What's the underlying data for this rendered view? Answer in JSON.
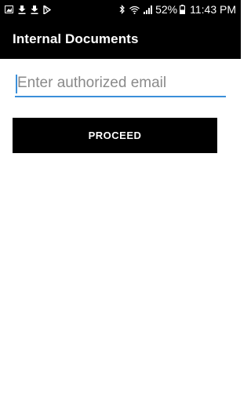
{
  "status_bar": {
    "left_icons": [
      "image-icon",
      "download-icon",
      "download-icon",
      "play-store-icon"
    ],
    "right_icons": [
      "bluetooth-icon",
      "wifi-icon",
      "signal-icon"
    ],
    "battery_percent": "52%",
    "time": "11:43 PM"
  },
  "app_bar": {
    "title": "Internal Documents"
  },
  "form": {
    "email_placeholder": "Enter authorized email",
    "email_value": "",
    "proceed_label": "PROCEED"
  },
  "colors": {
    "bar_background": "#000000",
    "accent": "#3b8fd9",
    "button_background": "#000000",
    "button_text": "#ffffff"
  }
}
